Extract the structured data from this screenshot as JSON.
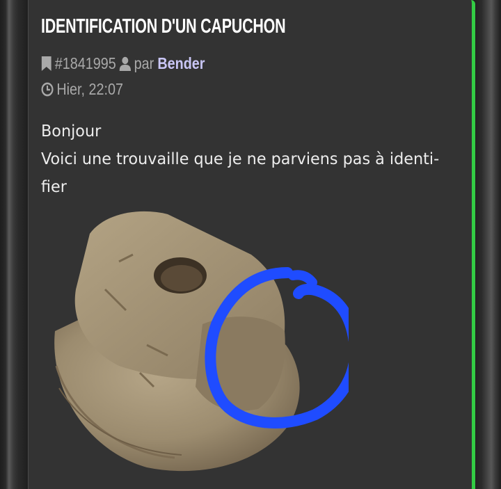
{
  "post": {
    "title": "IDENTIFICATION D'UN CAPUCHON",
    "post_id": "#1841995",
    "by_label": "par",
    "author": "Bender",
    "timestamp": "Hier, 22:07",
    "body_lines": [
      "Bonjour",
      "Voici une trouvaille que je ne parviens pas à identi-",
      "fier"
    ],
    "image": {
      "description_icon": "photo-of-stone-artifact",
      "annotation_color": "#1f4cff"
    }
  },
  "colors": {
    "card_background": "#333333",
    "accent_border": "#33cc44",
    "author_link": "#c9c6f5",
    "meta_text": "#a9a9a9"
  },
  "icons": {
    "bookmark": "bookmark-icon",
    "user": "user-icon",
    "clock": "clock-icon"
  }
}
